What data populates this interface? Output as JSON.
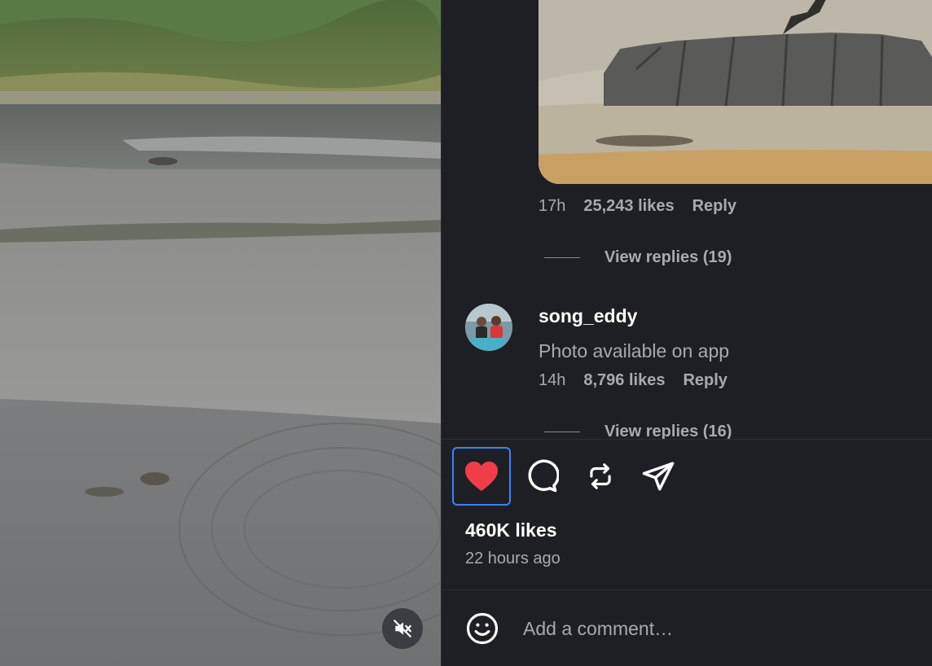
{
  "comments": [
    {
      "time": "17h",
      "likes": "25,243 likes",
      "reply_label": "Reply",
      "view_replies": "View replies (19)"
    },
    {
      "username": "song_eddy",
      "text": "Photo available on app",
      "time": "14h",
      "likes": "8,796 likes",
      "reply_label": "Reply",
      "view_replies": "View replies (16)"
    }
  ],
  "actions": {
    "like_icon": "heart-filled-icon",
    "comment_icon": "comment-bubble-icon",
    "repost_icon": "repost-icon",
    "share_icon": "send-icon",
    "like_color": "#ef3e4a",
    "focus_color": "#3b82f6"
  },
  "post": {
    "likes": "460K likes",
    "posted": "22 hours ago"
  },
  "composer": {
    "placeholder": "Add a comment…",
    "emoji_icon": "smiley-icon"
  },
  "video": {
    "mute_icon": "muted-speaker-icon"
  }
}
